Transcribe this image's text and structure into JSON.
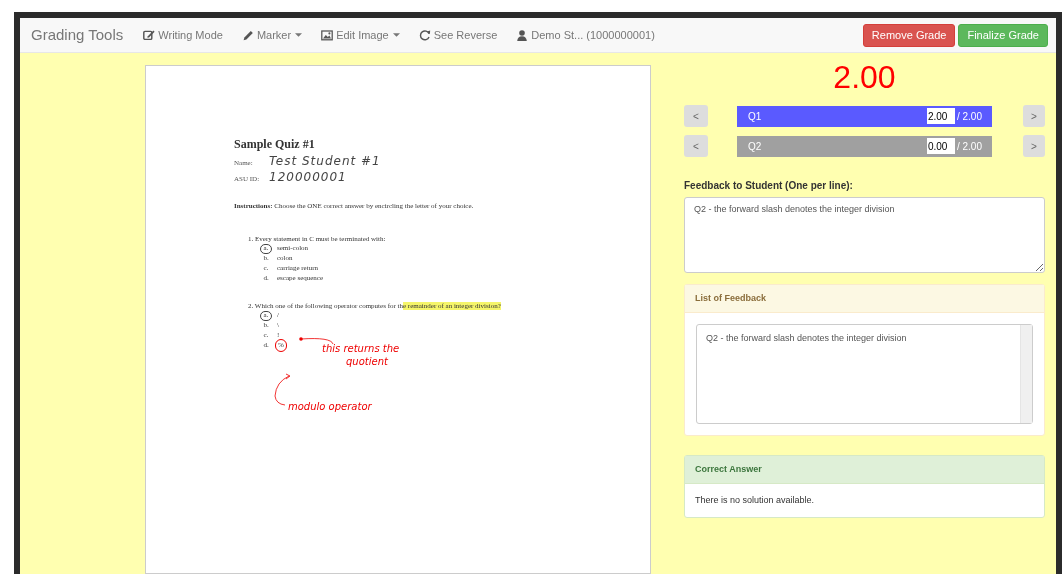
{
  "navbar": {
    "brand": "Grading Tools",
    "items": [
      {
        "label": "Writing Mode",
        "dropdown": false
      },
      {
        "label": "Marker",
        "dropdown": true
      },
      {
        "label": "Edit Image",
        "dropdown": true
      },
      {
        "label": "See Reverse",
        "dropdown": false
      },
      {
        "label": "Demo St... (1000000001)",
        "dropdown": false
      }
    ],
    "buttons": [
      {
        "label": "Remove Grade",
        "kind": "danger"
      },
      {
        "label": "Finalize Grade",
        "kind": "success"
      }
    ]
  },
  "document": {
    "title": "Sample Quiz #1",
    "fields": [
      {
        "label": "Name:",
        "value": "Test Student #1"
      },
      {
        "label": "ASU ID:",
        "value": "120000001"
      }
    ],
    "instructions": "**Instructions:** Choose the ONE correct answer by encircling the letter of your choice.",
    "questions": [
      {
        "number": "1.",
        "text": "Every statement in C must be terminated with:",
        "choices": [
          {
            "letter": "a.",
            "text": "semi-colon",
            "circled": true,
            "marked": false
          },
          {
            "letter": "b.",
            "text": "colon",
            "circled": false,
            "marked": false
          },
          {
            "letter": "c.",
            "text": "carriage return",
            "circled": false,
            "marked": false
          },
          {
            "letter": "d.",
            "text": "escape sequence",
            "circled": false,
            "marked": false
          }
        ]
      },
      {
        "number": "2.",
        "text": "Which one of the following operator computes for th",
        "highlight": "e remainder of an integer division?",
        "choices": [
          {
            "letter": "a.",
            "text": "/",
            "circled": true,
            "marked": false
          },
          {
            "letter": "b.",
            "text": "\\",
            "circled": false,
            "marked": false
          },
          {
            "letter": "c.",
            "text": "!",
            "circled": false,
            "marked": false
          },
          {
            "letter": "d.",
            "text": "%",
            "circled": false,
            "marked": true
          }
        ]
      }
    ],
    "annotations": [
      {
        "lines": [
          "this returns the",
          "quotient"
        ]
      },
      {
        "lines": [
          "modulo operator"
        ]
      }
    ]
  },
  "grade": "2.00",
  "questions": [
    {
      "label": "Q1",
      "score": "2.00",
      "max": "/ 2.00",
      "selected": true,
      "prev": "<",
      "next": ">"
    },
    {
      "label": "Q2",
      "score": "0.00",
      "max": "/ 2.00",
      "selected": false,
      "prev": "<",
      "next": ">"
    }
  ],
  "feedback": {
    "label": "Feedback to Student (One per line):",
    "value": "Q2 - the forward slash denotes the integer division"
  },
  "feedback_list": {
    "title": "List of Feedback",
    "items": [
      "Q2 - the forward slash denotes the integer division"
    ]
  },
  "correct_answer": {
    "title": "Correct Answer",
    "body": "There is no solution available."
  }
}
